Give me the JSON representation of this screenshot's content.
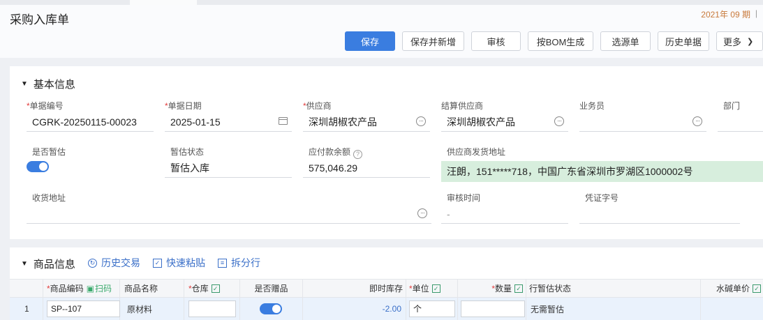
{
  "header": {
    "title": "采购入库单",
    "period": "2021年 09 期",
    "period_sep": "|"
  },
  "toolbar": {
    "save": "保存",
    "save_new": "保存并新增",
    "audit": "审核",
    "bom": "按BOM生成",
    "source": "选源单",
    "history": "历史单据",
    "more": "更多",
    "more_chevron": "chevron-down-icon",
    "primary_color": "#3a7de0"
  },
  "basic": {
    "section_title": "基本信息",
    "doc_no": {
      "label": "单据编号",
      "value": "CGRK-20250115-00023"
    },
    "doc_date": {
      "label": "单据日期",
      "value": "2025-01-15"
    },
    "supplier": {
      "label": "供应商",
      "value": "深圳胡椒农产品"
    },
    "settle_supplier": {
      "label": "结算供应商",
      "value": "深圳胡椒农产品"
    },
    "salesman": {
      "label": "业务员",
      "value": ""
    },
    "dept": {
      "label": "部门",
      "value": ""
    },
    "is_estimate": {
      "label": "是否暂估",
      "checked": true
    },
    "estimate_status": {
      "label": "暂估状态",
      "value": "暂估入库"
    },
    "payable": {
      "label": "应付款余额",
      "value": "575,046.29",
      "help": "?"
    },
    "ship_addr": {
      "label": "供应商发货地址",
      "value": "汪朗，151*****718，中国广东省深圳市罗湖区1000002号",
      "bg": "#d7eedd"
    },
    "recv_addr": {
      "label": "收货地址",
      "value": ""
    },
    "audit_time": {
      "label": "审核时间",
      "value": "-"
    },
    "voucher": {
      "label": "凭证字号",
      "value": ""
    }
  },
  "goods": {
    "section_title": "商品信息",
    "tools": {
      "history": "历史交易",
      "paste": "快速粘贴",
      "split": "拆分行"
    },
    "columns": {
      "code": "商品编码",
      "scan": "扫码",
      "name": "商品名称",
      "warehouse": "仓库",
      "gift": "是否赠品",
      "stock": "即时库存",
      "unit": "单位",
      "qty": "数量",
      "row_status": "行暂估状态",
      "price": "水碱单价"
    },
    "rows": [
      {
        "idx": "1",
        "code": "SP--107",
        "name": "原材料",
        "warehouse": "",
        "gift": true,
        "stock": "-2.00",
        "unit": "个",
        "qty": "",
        "row_status": "无需暂估",
        "price": ""
      }
    ]
  }
}
